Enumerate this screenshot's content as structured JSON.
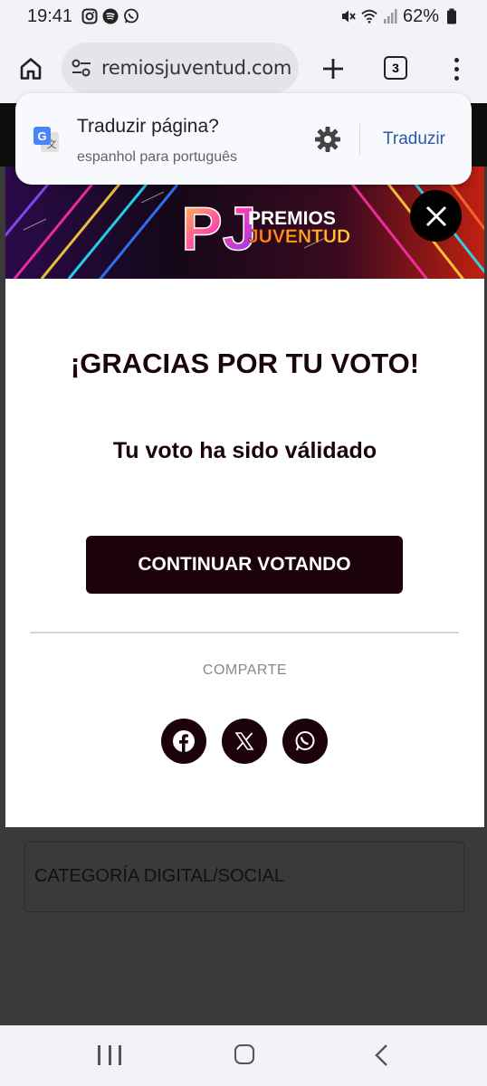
{
  "status_bar": {
    "time": "19:41",
    "battery": "62%",
    "left_icons": [
      "instagram-icon",
      "spotify-icon",
      "whatsapp-icon"
    ],
    "right_icons": [
      "mute-icon",
      "wifi-icon",
      "signal-icon",
      "battery-icon"
    ]
  },
  "browser": {
    "url": "remiosjuventud.com",
    "tab_count": "3"
  },
  "translate_popup": {
    "title": "Traduzir página?",
    "subtitle": "espanhol para português",
    "action": "Traduzir"
  },
  "modal": {
    "banner_logo_line1": "PREMIOS",
    "banner_logo_line2": "JUVENTUD",
    "banner_logo_mark": "PJ",
    "heading": "¡GRACIAS POR TU VOTO!",
    "subheading": "Tu voto ha sido válidado",
    "continue_label": "CONTINUAR VOTANDO",
    "share_label": "COMPARTE",
    "share_buttons": [
      "facebook-icon",
      "x-icon",
      "whatsapp-icon"
    ]
  },
  "background_page": {
    "category_label": "CATEGORÍA DIGITAL/SOCIAL"
  },
  "colors": {
    "accent_dark": "#1c0309",
    "translate_link": "#2a5aa3",
    "chrome_bg": "#f1f3f7"
  }
}
